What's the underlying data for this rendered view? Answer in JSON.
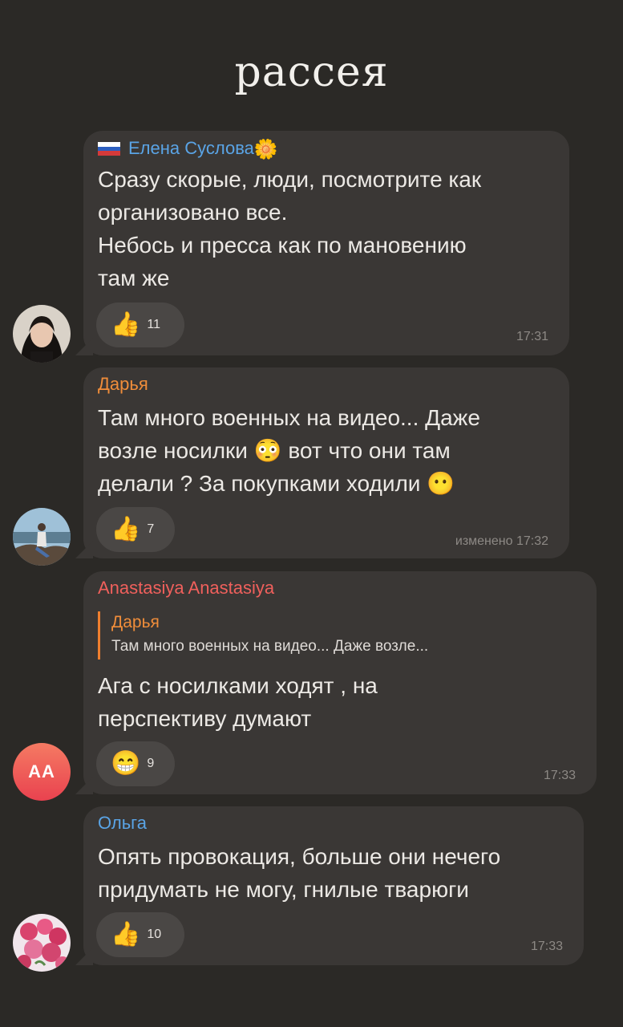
{
  "header": {
    "title": "рассея"
  },
  "messages": [
    {
      "author": "Елена Суслова",
      "author_color": "#5aa4e6",
      "name_suffix_emoji": "🌼",
      "text": "Сразу скорые, люди, посмотрите как\nорганизовано все.\nНебось и пресса как по мановению\nтам же",
      "reaction_emoji": "👍",
      "reaction_count": "11",
      "time": "17:31"
    },
    {
      "author": "Дарья",
      "author_color": "#f08d3a",
      "text": "Там много военных  на видео... Даже\nвозле носилки 😳 вот что они там\nделали ? За покупками ходили 😶",
      "reaction_emoji": "👍",
      "reaction_count": "7",
      "time": "изменено 17:32"
    },
    {
      "author": "Anastasiya Anastasiya",
      "author_color": "#f0605c",
      "avatar_initials": "AA",
      "reply_author": "Дарья",
      "reply_text": "Там много военных  на видео... Даже возле...",
      "text": "Ага с носилками ходят , на\nперспективу думают",
      "reaction_emoji": "😁",
      "reaction_count": "9",
      "time": "17:33"
    },
    {
      "author": "Ольга",
      "author_color": "#5aa4e6",
      "text": "Опять провокация, больше они нечего\nпридумать не могу, гнилые тварюги",
      "reaction_emoji": "👍",
      "reaction_count": "10",
      "time": "17:33"
    }
  ]
}
